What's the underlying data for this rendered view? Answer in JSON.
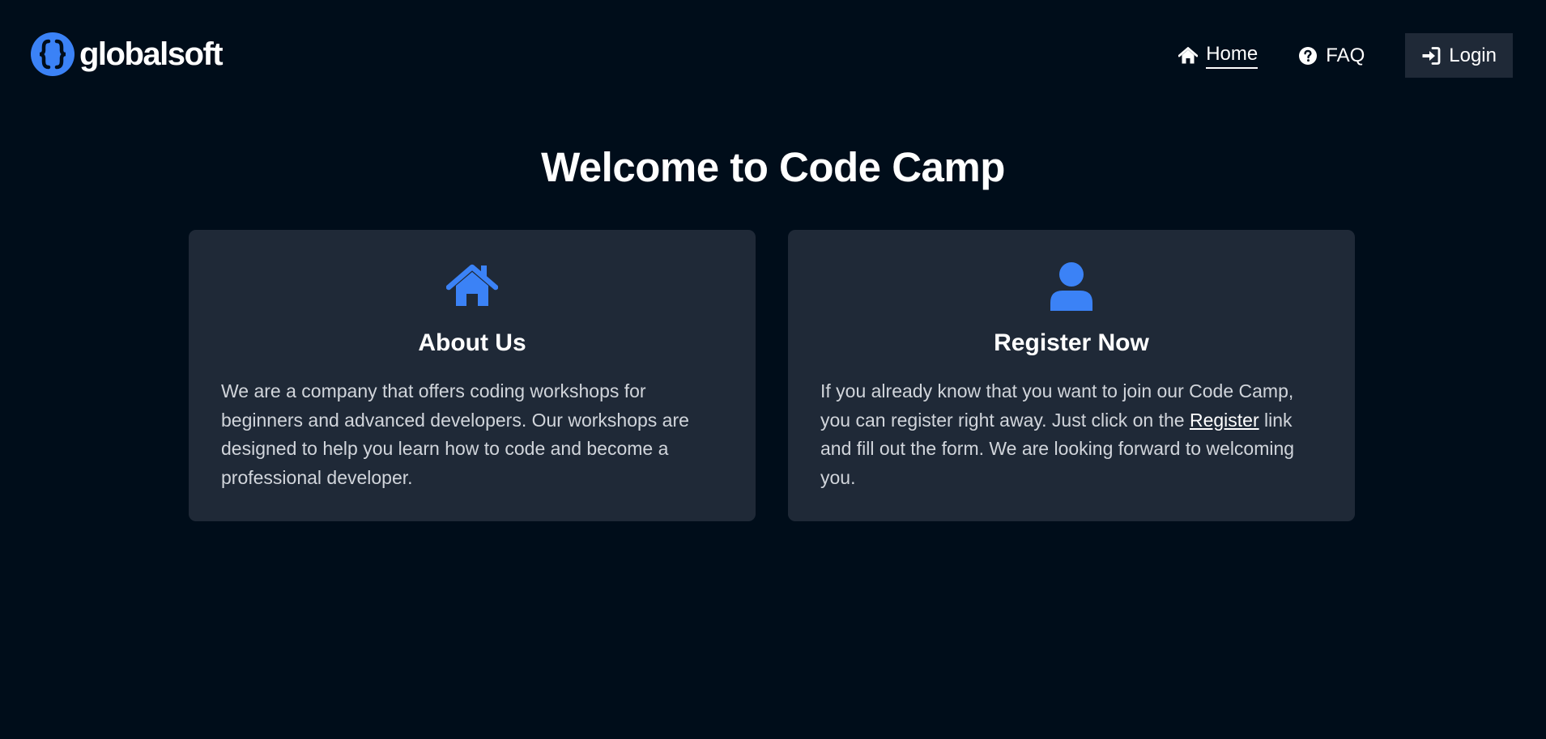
{
  "header": {
    "brand_name": "globalsoft",
    "nav": {
      "home_label": "Home",
      "faq_label": "FAQ",
      "login_label": "Login"
    }
  },
  "main": {
    "title": "Welcome to Code Camp",
    "cards": [
      {
        "icon": "house-icon",
        "title": "About Us",
        "body": "We are a company that offers coding workshops for beginners and advanced developers. Our workshops are designed to help you learn how to code and become a professional developer."
      },
      {
        "icon": "user-icon",
        "title": "Register Now",
        "body_before": "If you already know that you want to join our Code Camp, you can register right away. Just click on the ",
        "link_label": "Register",
        "body_after": " link and fill out the form. We are looking forward to welcoming you."
      }
    ]
  },
  "colors": {
    "background": "#000d1a",
    "card": "#1f2937",
    "accent": "#3b82f6",
    "body_text": "#d1d5db"
  }
}
